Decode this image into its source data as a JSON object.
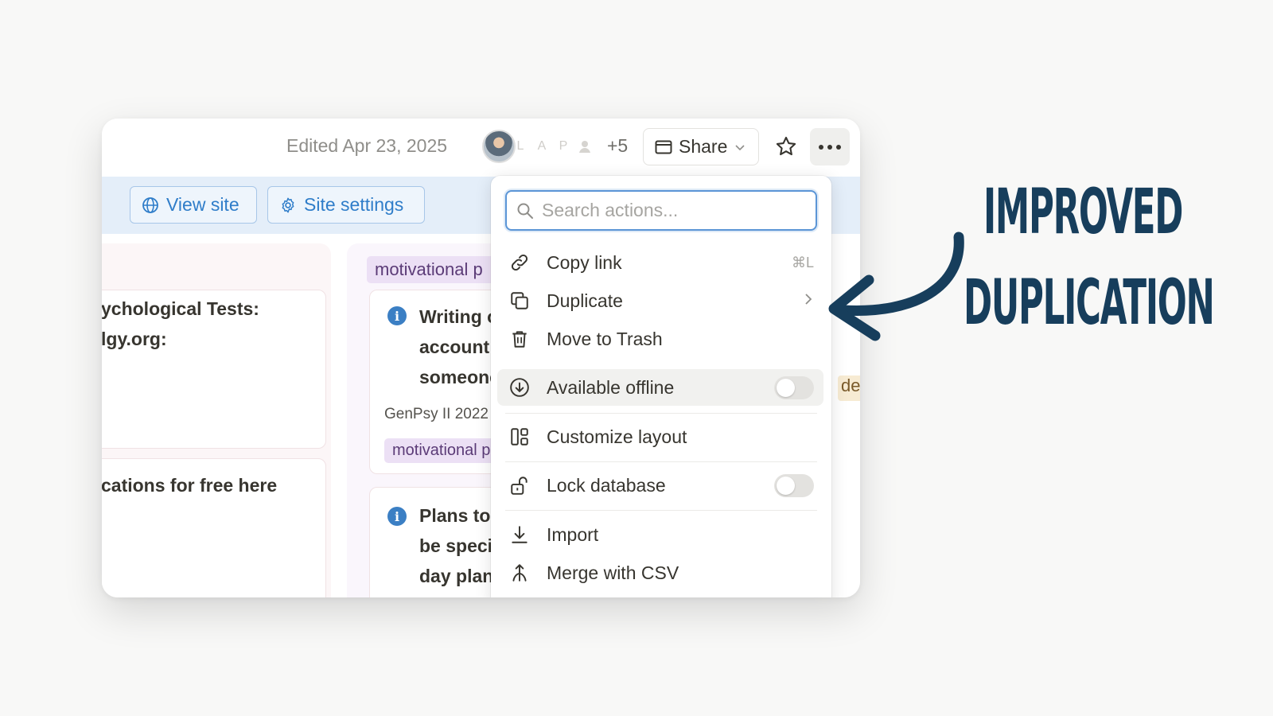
{
  "topbar": {
    "edited": "Edited Apr 23, 2025",
    "avatars": [
      "L",
      "A",
      "P"
    ],
    "more_count": "+5",
    "share_label": "Share"
  },
  "banner": {
    "view_site": "View site",
    "site_settings": "Site settings"
  },
  "board": {
    "col1": {
      "card1_lines": [
        "ychological Tests:",
        "lgy.org:"
      ],
      "card2_lines": [
        "cations for free here"
      ]
    },
    "col2": {
      "tag": "motivational p",
      "card1_lines": [
        "Writing o",
        "account",
        "someone"
      ],
      "card1_meta": "GenPsy II 2022",
      "card1_tag": "motivational p",
      "card2_lines": [
        "Plans to",
        "be speci",
        "day plan"
      ]
    },
    "peek_tag": "de"
  },
  "menu": {
    "search_placeholder": "Search actions...",
    "items": [
      {
        "label": "Copy link",
        "shortcut": "⌘L"
      },
      {
        "label": "Duplicate"
      },
      {
        "label": "Move to Trash"
      },
      {
        "label": "Available offline",
        "toggle_on": false
      },
      {
        "label": "Customize layout"
      },
      {
        "label": "Lock database",
        "toggle_on": false
      },
      {
        "label": "Import"
      },
      {
        "label": "Merge with CSV"
      }
    ]
  },
  "annotation": {
    "line1": "IMPROVED",
    "line2": "DUPLICATION",
    "color": "#173e5c"
  }
}
